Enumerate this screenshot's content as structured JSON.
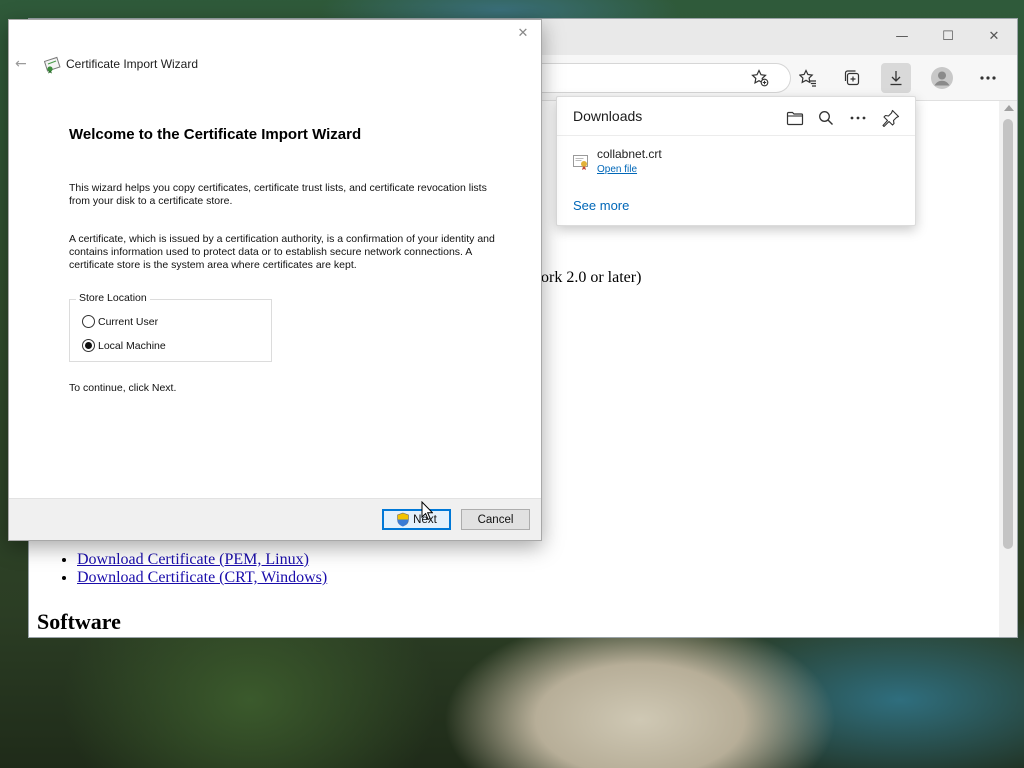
{
  "browser": {
    "toolbar_icons": [
      "add-favorite-icon",
      "favorites-icon",
      "collections-icon",
      "downloads-icon",
      "profile-icon",
      "more-icon"
    ],
    "page": {
      "partial_text": "ork 2.0 or later)",
      "links": [
        "Download Certificate (PEM, Linux)",
        "Download Certificate (CRT, Windows)"
      ],
      "heading": "Software"
    }
  },
  "downloads": {
    "title": "Downloads",
    "header_icons": [
      "folder-icon",
      "search-icon",
      "more-icon",
      "pin-icon"
    ],
    "file_name": "collabnet.crt",
    "open_file": "Open file",
    "see_more": "See more"
  },
  "wizard": {
    "title": "Certificate Import Wizard",
    "welcome": "Welcome to the Certificate Import Wizard",
    "para1": "This wizard helps you copy certificates, certificate trust lists, and certificate revocation lists from your disk to a certificate store.",
    "para2": "A certificate, which is issued by a certification authority, is a confirmation of your identity and contains information used to protect data or to establish secure network connections. A certificate store is the system area where certificates are kept.",
    "store_location": {
      "legend": "Store Location",
      "options": [
        "Current User",
        "Local Machine"
      ],
      "selected": "Local Machine"
    },
    "continue_text": "To continue, click Next.",
    "next_label": "Next",
    "cancel_label": "Cancel"
  },
  "colors": {
    "accent": "#0078d7",
    "link": "#1a0dab",
    "download_link": "#0067b8"
  }
}
